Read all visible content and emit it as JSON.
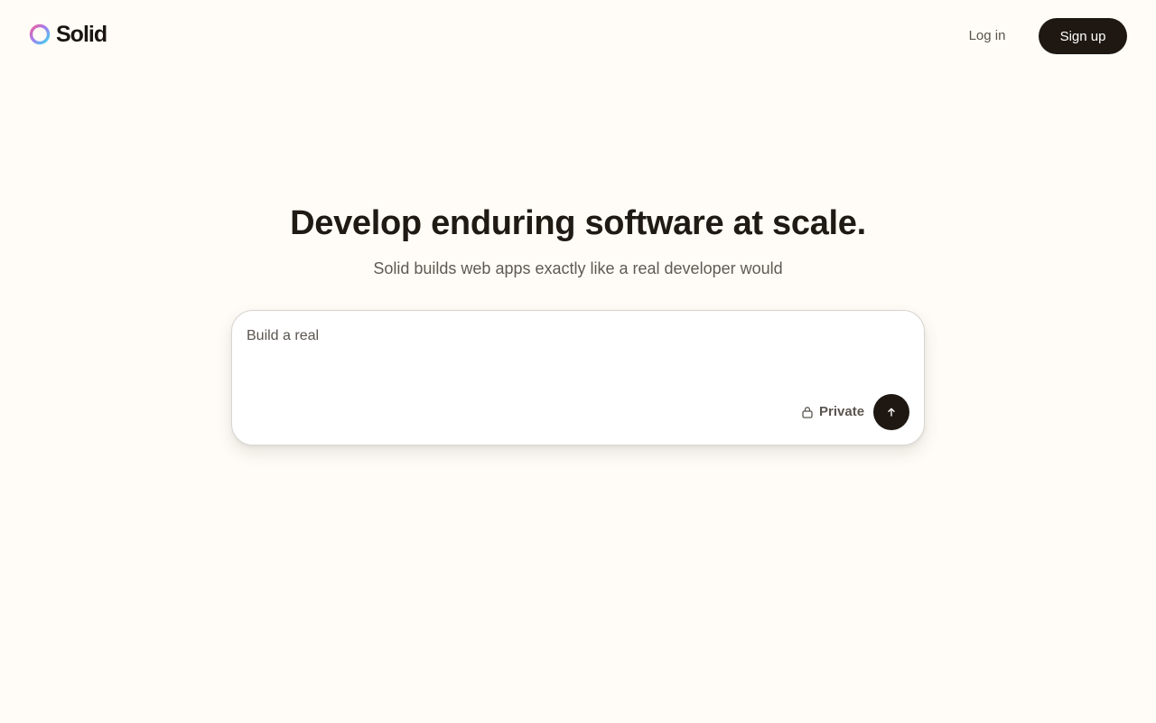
{
  "header": {
    "brand_name": "Solid",
    "login_label": "Log in",
    "signup_label": "Sign up"
  },
  "hero": {
    "title": "Develop enduring software at scale.",
    "subtitle": "Solid builds web apps exactly like a real developer would"
  },
  "prompt": {
    "value": "Build a real",
    "placeholder": "Build a real",
    "private_label": "Private"
  },
  "icons": {
    "logo": "solid-ring-logo",
    "lock": "lock-icon",
    "submit": "arrow-up-icon"
  },
  "colors": {
    "background": "#fffcf7",
    "primary_dark": "#1f1812",
    "text_muted": "#5f5a53"
  }
}
